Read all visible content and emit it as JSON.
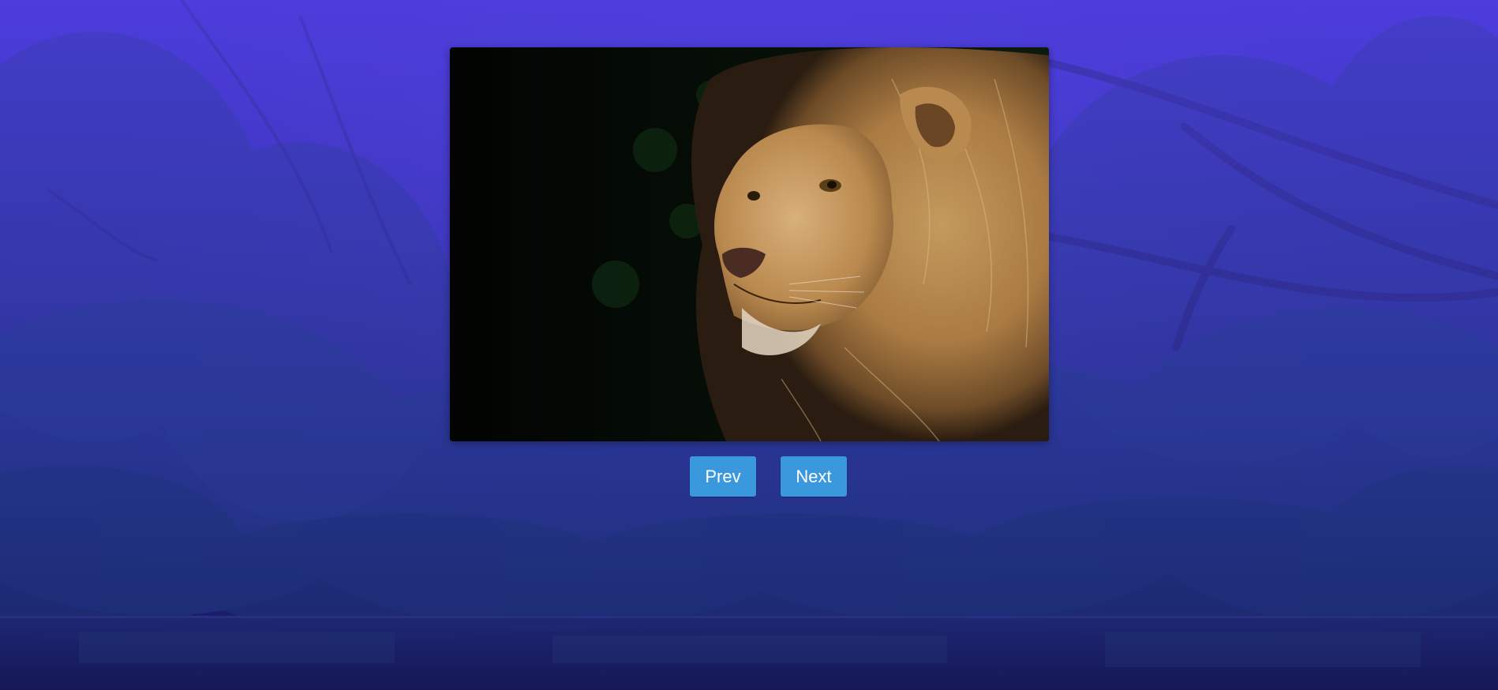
{
  "slider": {
    "image_alt": "lion-photo"
  },
  "controls": {
    "prev_label": "Prev",
    "next_label": "Next"
  }
}
